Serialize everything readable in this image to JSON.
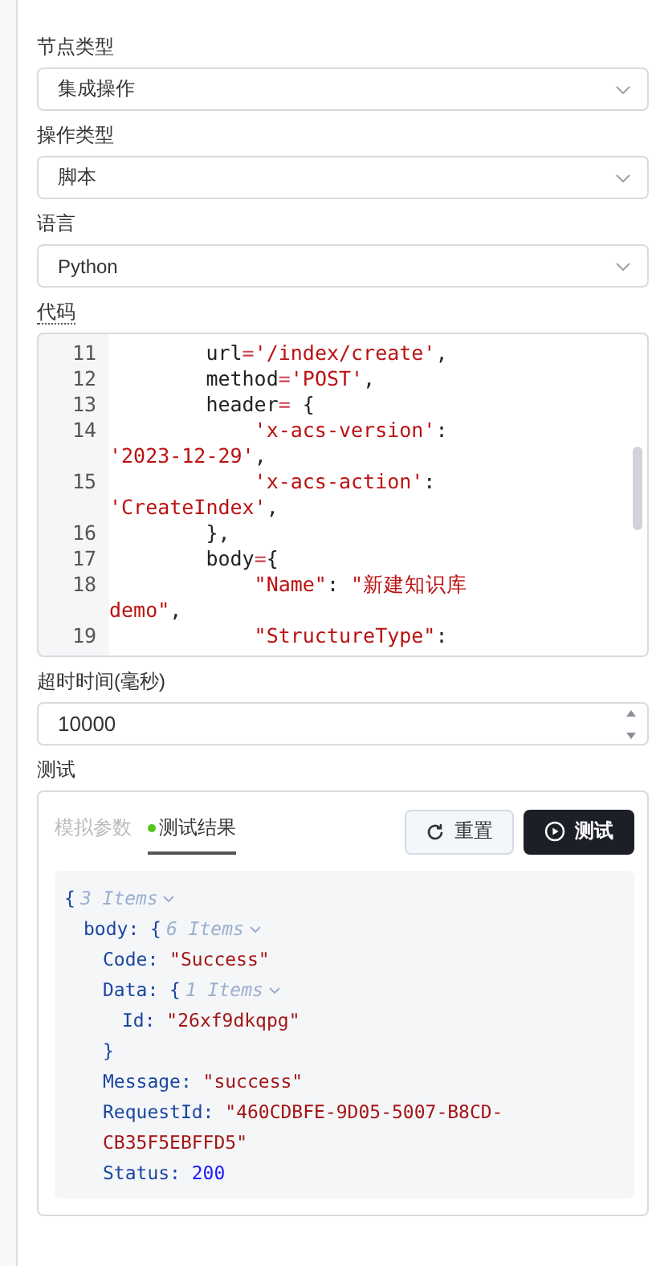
{
  "fields": [
    {
      "label": "节点类型",
      "kind": "select",
      "value": "集成操作"
    },
    {
      "label": "操作类型",
      "kind": "select",
      "value": "脚本"
    },
    {
      "label": "语言",
      "kind": "select",
      "value": "Python"
    }
  ],
  "code": {
    "label": "代码",
    "lines": [
      {
        "num": "11",
        "segs": [
          {
            "t": "        url",
            "kind": "name"
          },
          {
            "t": "=",
            "kind": "op"
          },
          {
            "t": "'/index/create'",
            "kind": "str"
          },
          {
            "t": ",",
            "kind": "name"
          }
        ]
      },
      {
        "num": "12",
        "segs": [
          {
            "t": "        method",
            "kind": "name"
          },
          {
            "t": "=",
            "kind": "op"
          },
          {
            "t": "'POST'",
            "kind": "str"
          },
          {
            "t": ",",
            "kind": "name"
          }
        ]
      },
      {
        "num": "13",
        "segs": [
          {
            "t": "        header",
            "kind": "name"
          },
          {
            "t": "=",
            "kind": "op"
          },
          {
            "t": " {",
            "kind": "name"
          }
        ]
      },
      {
        "num": "14",
        "segs": [
          {
            "t": "            'x-acs-version'",
            "kind": "str"
          },
          {
            "t": ":",
            "kind": "name"
          }
        ]
      },
      {
        "segs": [
          {
            "t": "'2023-12-29'",
            "kind": "str"
          },
          {
            "t": ",",
            "kind": "name"
          }
        ]
      },
      {
        "num": "15",
        "segs": [
          {
            "t": "            'x-acs-action'",
            "kind": "str"
          },
          {
            "t": ":",
            "kind": "name"
          }
        ]
      },
      {
        "segs": [
          {
            "t": "'CreateIndex'",
            "kind": "str"
          },
          {
            "t": ",",
            "kind": "name"
          }
        ]
      },
      {
        "num": "16",
        "segs": [
          {
            "t": "        },",
            "kind": "name"
          }
        ]
      },
      {
        "num": "17",
        "segs": [
          {
            "t": "        body",
            "kind": "name"
          },
          {
            "t": "=",
            "kind": "op"
          },
          {
            "t": "{",
            "kind": "name"
          }
        ]
      },
      {
        "num": "18",
        "segs": [
          {
            "t": "            \"Name\"",
            "kind": "str"
          },
          {
            "t": ": ",
            "kind": "name"
          },
          {
            "t": "\"新建知识库",
            "kind": "str"
          }
        ]
      },
      {
        "segs": [
          {
            "t": "demo\"",
            "kind": "str"
          },
          {
            "t": ",",
            "kind": "name"
          }
        ]
      },
      {
        "num": "19",
        "segs": [
          {
            "t": "            \"StructureType\"",
            "kind": "str"
          },
          {
            "t": ":",
            "kind": "name"
          }
        ]
      }
    ]
  },
  "timeout": {
    "label": "超时时间(毫秒)",
    "value": "10000"
  },
  "test": {
    "label": "测试",
    "tabs": [
      {
        "label": "模拟参数",
        "selected": false
      },
      {
        "label": "测试结果",
        "selected": true
      }
    ],
    "buttons": [
      {
        "label": "重置",
        "kind": "reset"
      },
      {
        "label": "测试",
        "kind": "run"
      }
    ],
    "result": {
      "kind": "object",
      "open": "{",
      "meta": "3 Items",
      "children": [
        {
          "kind": "object",
          "key": "body:",
          "open": "{",
          "meta": "6 Items",
          "children": [
            {
              "kind": "string",
              "key": "Code:",
              "value": "\"Success\""
            },
            {
              "kind": "object",
              "key": "Data:",
              "open": "{",
              "meta": "1 Items",
              "close": "}",
              "children": [
                {
                  "kind": "string",
                  "key": "Id:",
                  "value": "\"26xf9dkqpg\""
                }
              ]
            },
            {
              "kind": "string",
              "key": "Message:",
              "value": "\"success\""
            },
            {
              "kind": "string",
              "key": "RequestId:",
              "value": "\"460CDBFE-9D05-5007-B8CD-CB35F5EBFFD5\""
            },
            {
              "kind": "number",
              "key": "Status:",
              "value": "200"
            }
          ]
        }
      ]
    }
  }
}
